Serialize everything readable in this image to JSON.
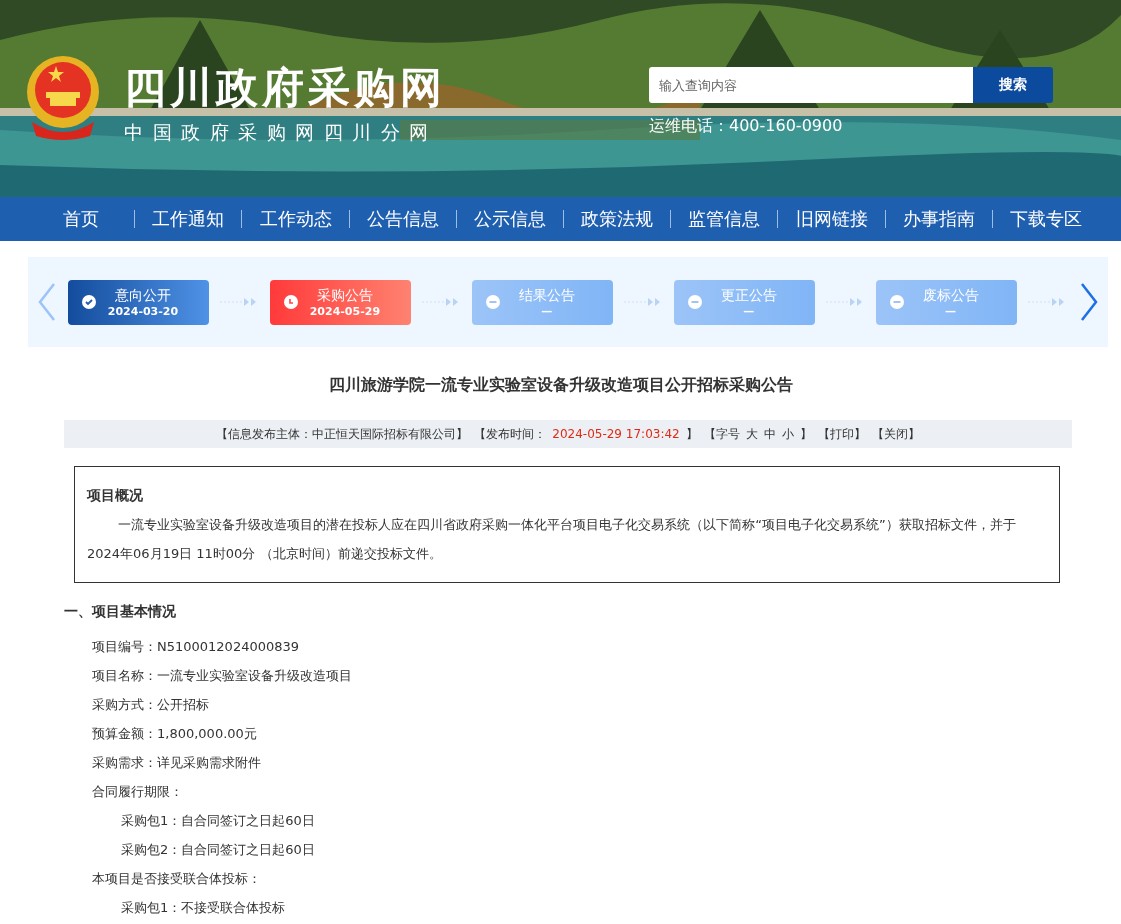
{
  "header": {
    "title": "四川政府采购网",
    "subtitle": "中国政府采购网四川分网",
    "search": {
      "placeholder": "输入查询内容",
      "button": "搜索"
    },
    "hotline": "运维电话：400-160-0900"
  },
  "nav": [
    {
      "label": "首页",
      "selected": false
    },
    {
      "label": "工作通知",
      "selected": false
    },
    {
      "label": "工作动态",
      "selected": false
    },
    {
      "label": "公告信息",
      "selected": false
    },
    {
      "label": "公示信息",
      "selected": false
    },
    {
      "label": "政策法规",
      "selected": false
    },
    {
      "label": "监管信息",
      "selected": false
    },
    {
      "label": "旧网链接",
      "selected": false
    },
    {
      "label": "办事指南",
      "selected": false
    },
    {
      "label": "下载专区",
      "selected": false
    }
  ],
  "steps": [
    {
      "kind": "done",
      "label": "意向公开",
      "date": "2024-03-20"
    },
    {
      "kind": "current",
      "label": "采购公告",
      "date": "2024-05-29"
    },
    {
      "kind": "pending",
      "label": "结果公告",
      "date": "—"
    },
    {
      "kind": "pending",
      "label": "更正公告",
      "date": "—"
    },
    {
      "kind": "pending",
      "label": "废标公告",
      "date": "—"
    }
  ],
  "title": "四川旅游学院一流专业实验室设备升级改造项目公开招标采购公告",
  "meta": {
    "publisher": "【信息发布主体：中正恒天国际招标有限公司】",
    "time_label": "【发布时间：",
    "time": "2024-05-29 17:03:42",
    "time_end": "】",
    "font_label": "【字号",
    "font_sizes": [
      "大",
      "中",
      "小"
    ],
    "font_end": "】",
    "actions": [
      "【打印】",
      "【关闭】"
    ]
  },
  "overview": {
    "heading": "项目概况",
    "text": "一流专业实验室设备升级改造项目的潜在投标人应在四川省政府采购一体化平台项目电子化交易系统（以下简称“项目电子化交易系统”）获取招标文件，并于 2024年06月19日 11时00分 （北京时间）前递交投标文件。"
  },
  "section": {
    "heading": "一、项目基本情况",
    "items": [
      {
        "text": "项目编号：N5100012024000839"
      },
      {
        "text": "项目名称：一流专业实验室设备升级改造项目"
      },
      {
        "text": "采购方式：公开招标"
      },
      {
        "text": "预算金额：1,800,000.00元"
      },
      {
        "text": "采购需求：详见采购需求附件"
      },
      {
        "text": "合同履行期限：",
        "children": [
          {
            "text": "采购包1：自合同签订之日起60日"
          },
          {
            "text": "采购包2：自合同签订之日起60日"
          }
        ]
      },
      {
        "text": "本项目是否接受联合体投标：",
        "children": [
          {
            "text": "采购包1：不接受联合体投标"
          }
        ]
      }
    ]
  }
}
